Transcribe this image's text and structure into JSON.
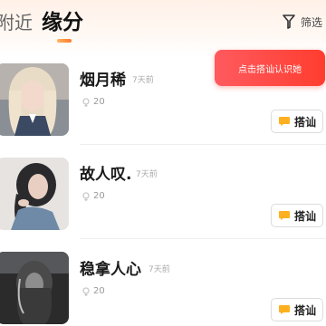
{
  "tabs": {
    "nearby": "附近",
    "fate": "缘分"
  },
  "filter": {
    "label": "筛选",
    "icon": "filter-icon"
  },
  "toast": {
    "text": "点击搭讪认识她"
  },
  "users": [
    {
      "name": "烟月稀",
      "time": "7天前",
      "age": "20",
      "chat_label": "搭讪"
    },
    {
      "name": "故人叹.",
      "time": "7天前",
      "age": "20",
      "chat_label": "搭讪"
    },
    {
      "name": "稳拿人心",
      "time": "7天前",
      "age": "20",
      "chat_label": "搭讪"
    }
  ],
  "colors": {
    "accent": "#ff7a2e",
    "toast": "#ff4a45",
    "chat_icon": "#ffb020",
    "gender_female": "#c9c9c9"
  }
}
